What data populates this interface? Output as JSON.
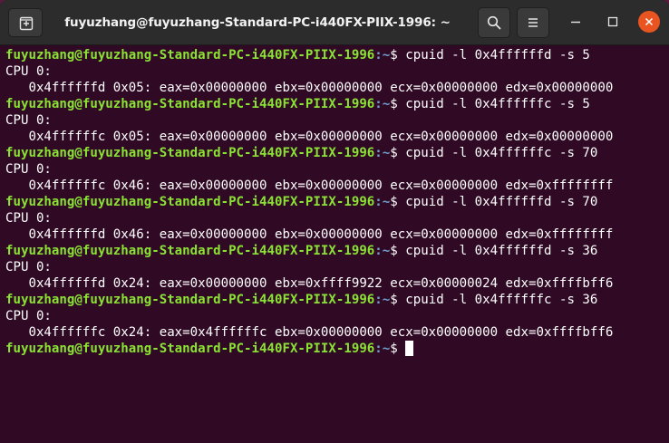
{
  "window": {
    "title": "fuyuzhang@fuyuzhang-Standard-PC-i440FX-PIIX-1996: ~"
  },
  "icons": {
    "new_tab": "new-tab-icon",
    "search": "search-icon",
    "menu": "hamburger-menu-icon",
    "minimize": "minimize-icon",
    "maximize": "maximize-icon",
    "close": "close-icon"
  },
  "colors": {
    "terminal_bg": "#300a24",
    "prompt_user": "#8ae234",
    "prompt_path": "#729fcf",
    "close_button": "#e95420"
  },
  "prompt": {
    "user_host": "fuyuzhang@fuyuzhang-Standard-PC-i440FX-PIIX-1996",
    "path": ":~",
    "symbol": "$ "
  },
  "terminal": {
    "lines": [
      {
        "type": "cmd",
        "text": "cpuid -l 0x4ffffffd -s 5"
      },
      {
        "type": "out",
        "text": "CPU 0:"
      },
      {
        "type": "out",
        "text": "   0x4ffffffd 0x05: eax=0x00000000 ebx=0x00000000 ecx=0x00000000 edx=0x00000000"
      },
      {
        "type": "cmd",
        "text": "cpuid -l 0x4ffffffc -s 5"
      },
      {
        "type": "out",
        "text": "CPU 0:"
      },
      {
        "type": "out",
        "text": "   0x4ffffffc 0x05: eax=0x00000000 ebx=0x00000000 ecx=0x00000000 edx=0x00000000"
      },
      {
        "type": "cmd",
        "text": "cpuid -l 0x4ffffffc -s 70"
      },
      {
        "type": "out",
        "text": "CPU 0:"
      },
      {
        "type": "out",
        "text": "   0x4ffffffc 0x46: eax=0x00000000 ebx=0x00000000 ecx=0x00000000 edx=0xffffffff"
      },
      {
        "type": "cmd",
        "text": "cpuid -l 0x4ffffffd -s 70"
      },
      {
        "type": "out",
        "text": "CPU 0:"
      },
      {
        "type": "out",
        "text": "   0x4ffffffd 0x46: eax=0x00000000 ebx=0x00000000 ecx=0x00000000 edx=0xffffffff"
      },
      {
        "type": "cmd",
        "text": "cpuid -l 0x4ffffffd -s 36"
      },
      {
        "type": "out",
        "text": "CPU 0:"
      },
      {
        "type": "out",
        "text": "   0x4ffffffd 0x24: eax=0x00000000 ebx=0xffff9922 ecx=0x00000024 edx=0xffffbff6"
      },
      {
        "type": "cmd",
        "text": "cpuid -l 0x4ffffffc -s 36"
      },
      {
        "type": "out",
        "text": "CPU 0:"
      },
      {
        "type": "out",
        "text": "   0x4ffffffc 0x24: eax=0x4ffffffc ebx=0x00000000 ecx=0x00000000 edx=0xffffbff6"
      },
      {
        "type": "prompt",
        "text": ""
      }
    ]
  }
}
